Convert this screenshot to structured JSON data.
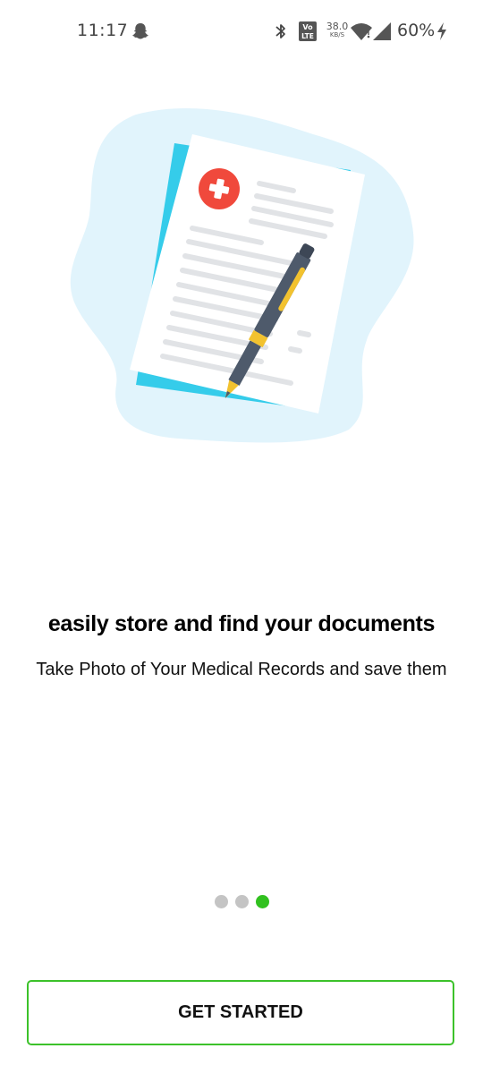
{
  "status_bar": {
    "time": "11:17",
    "network_speed_value": "38.0",
    "network_speed_unit": "KB/S",
    "volte_label": "Vo LTE",
    "battery_percent": "60%",
    "icons": [
      "snapchat-notification-icon",
      "bluetooth-icon",
      "volte-icon",
      "wifi-icon",
      "cell-signal-icon",
      "charging-icon"
    ]
  },
  "onboarding": {
    "illustration": "medical-document-with-pen",
    "headline": "easily store and find your documents",
    "subtitle": "Take Photo of Your Medical Records and save them",
    "page_indicator": {
      "total": 3,
      "current": 3
    }
  },
  "actions": {
    "get_started_label": "GET STARTED"
  },
  "colors": {
    "accent_green": "#31c11f",
    "blob_light_blue": "#e1f4fc",
    "paper_back_blue": "#35ccea",
    "medical_red": "#f0493c",
    "pen_gray": "#4e5a6b",
    "pen_yellow": "#f2c22f"
  }
}
